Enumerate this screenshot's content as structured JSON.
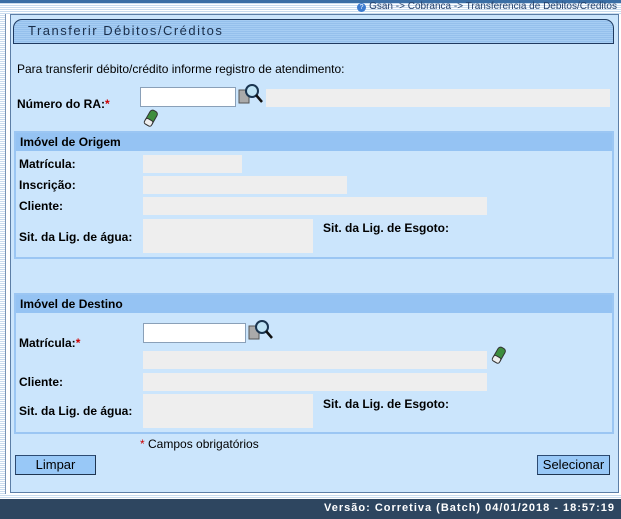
{
  "breadcrumb": "Gsan -> Cobranca -> Transferencia de Debitos/Creditos",
  "title": "Transferir Débitos/Créditos",
  "instruction": "Para transferir débito/crédito informe registro de atendimento:",
  "ra": {
    "label": "Número do RA:",
    "required": "*",
    "value": "",
    "description": ""
  },
  "origem": {
    "header": "Imóvel de Origem",
    "matricula_label": "Matrícula:",
    "inscricao_label": "Inscrição:",
    "cliente_label": "Cliente:",
    "agua_label": "Sit. da Lig. de água:",
    "esgoto_label": "Sit. da Lig. de Esgoto:"
  },
  "destino": {
    "header": "Imóvel de Destino",
    "matricula_label": "Matrícula:",
    "required": "*",
    "matricula_value": "",
    "cliente_label": "Cliente:",
    "agua_label": "Sit. da Lig. de água:",
    "esgoto_label": "Sit. da Lig. de Esgoto:"
  },
  "required_note": {
    "star": "*",
    "text": " Campos obrigatórios"
  },
  "buttons": {
    "limpar": "Limpar",
    "selecionar": "Selecionar"
  },
  "footer": "Versão: Corretiva (Batch) 04/01/2018 - 18:57:19",
  "icons": {
    "search": "magnifier-icon",
    "clear": "eraser-icon",
    "help": "help-icon"
  }
}
